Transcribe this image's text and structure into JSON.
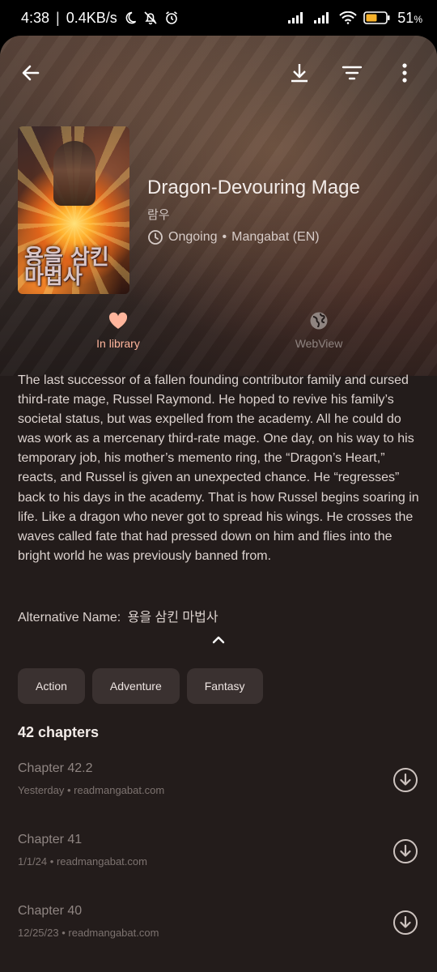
{
  "status_bar": {
    "time": "4:38",
    "network_speed": "0.4KB/s",
    "battery": "51",
    "battery_unit": "%",
    "icons": [
      "moon-icon",
      "bell-off-icon",
      "alarm-icon",
      "signal-icon",
      "signal-icon",
      "wifi-icon",
      "battery-icon"
    ]
  },
  "toolbar": {
    "back_icon": "arrow-left-icon",
    "download_icon": "download-icon",
    "filter_icon": "filter-icon",
    "more_icon": "more-vertical-icon"
  },
  "manga": {
    "title": "Dragon-Devouring Mage",
    "author": "람우",
    "status": "Ongoing",
    "separator": "•",
    "source": "Mangabat (EN)",
    "cover_text": "용을 삼킨 마법사"
  },
  "actions": {
    "library_label": "In library",
    "webview_label": "WebView"
  },
  "description": "The last successor of a fallen founding contributor family and cursed third-rate mage, Russel Raymond. He hoped to revive his family’s societal status, but was expelled from the academy. All he could do was work as a mercenary third-rate mage. One day, on his way to his temporary job, his mother’s memento ring, the “Dragon’s Heart,” reacts, and Russel is given an unexpected chance. He “regresses” back to his days in the academy. That is how Russel begins soaring in life. Like a dragon who never got to spread his wings. He crosses the waves called fate that had pressed down on him and flies into the bright world he was previously banned from.",
  "alternative": {
    "label": "Alternative Name:",
    "value": "용을 삼킨 마법사"
  },
  "genres": [
    "Action",
    "Adventure",
    "Fantasy"
  ],
  "chapter_count": "42 chapters",
  "chapters": [
    {
      "name": "Chapter 42.2",
      "date": "Yesterday",
      "source": "readmangabat.com"
    },
    {
      "name": "Chapter 41",
      "date": "1/1/24",
      "source": "readmangabat.com"
    },
    {
      "name": "Chapter 40",
      "date": "12/25/23",
      "source": "readmangabat.com"
    }
  ],
  "colors": {
    "accent": "#ffb59c",
    "background": "#231c1b",
    "chip": "#3a3130"
  }
}
